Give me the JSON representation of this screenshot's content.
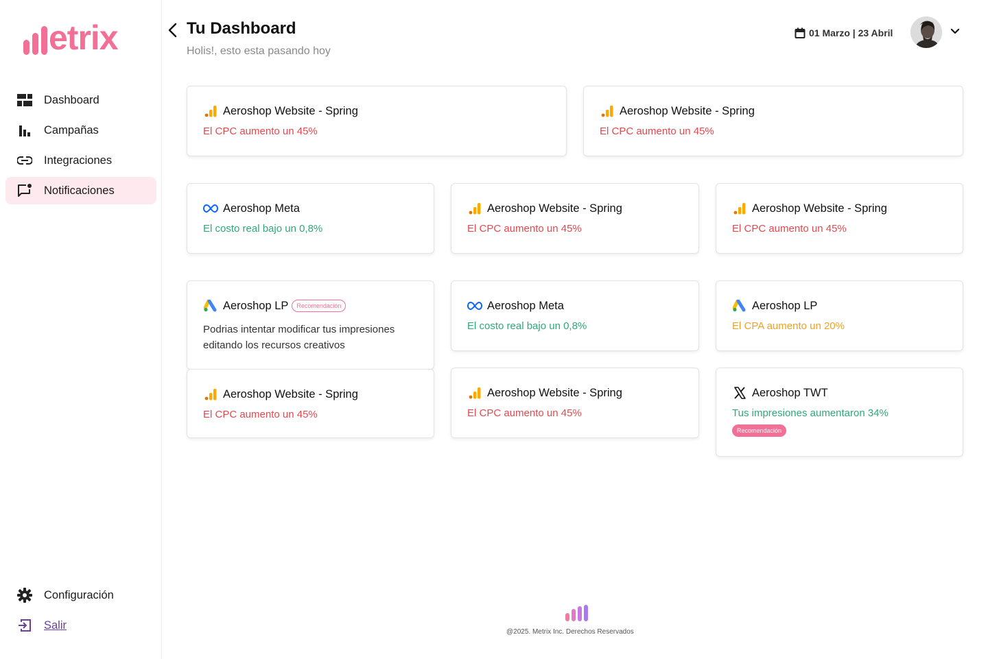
{
  "brand": {
    "name": "etrix",
    "color": "#f26f95"
  },
  "sidebar": {
    "items": [
      {
        "label": "Dashboard",
        "icon": "dashboard-icon"
      },
      {
        "label": "Campañas",
        "icon": "bar-chart-icon"
      },
      {
        "label": "Integraciones",
        "icon": "link-icon"
      },
      {
        "label": "Notificaciones",
        "icon": "notification-icon",
        "active": true
      }
    ],
    "bottom": [
      {
        "label": "Configuración",
        "icon": "gear-icon"
      },
      {
        "label": "Salir",
        "icon": "logout-icon"
      }
    ]
  },
  "header": {
    "title": "Tu Dashboard",
    "subtitle": "Holis!, esto esta pasando hoy",
    "date_range": "01 Marzo | 23 Abril"
  },
  "cards": [
    {
      "title": "Aeroshop Website - Spring",
      "message": "El CPC aumento un 45%",
      "icon": "google-analytics-icon",
      "tone": "red"
    },
    {
      "title": "Aeroshop Website - Spring",
      "message": "El CPC aumento un 45%",
      "icon": "google-analytics-icon",
      "tone": "red"
    },
    {
      "title": "Aeroshop Meta",
      "message": "El costo real bajo un 0,8%",
      "icon": "meta-icon",
      "tone": "green"
    },
    {
      "title": "Aeroshop Website - Spring",
      "message": "El CPC aumento un 45%",
      "icon": "google-analytics-icon",
      "tone": "red"
    },
    {
      "title": "Aeroshop Website - Spring",
      "message": "El CPC aumento un 45%",
      "icon": "google-analytics-icon",
      "tone": "red"
    },
    {
      "title": "Aeroshop LP",
      "badge": "Recomendación",
      "description": "Podrias intentar modificar tus impresiones editando los recursos creativos",
      "icon": "google-ads-icon"
    },
    {
      "title": "Aeroshop Meta",
      "message": "El costo real bajo un 0,8%",
      "icon": "meta-icon",
      "tone": "green"
    },
    {
      "title": "Aeroshop LP",
      "message": "El CPA aumento un 20%",
      "icon": "google-ads-icon",
      "tone": "orange"
    },
    {
      "title": "Aeroshop Website - Spring",
      "message": "El CPC aumento un 45%",
      "icon": "google-analytics-icon",
      "tone": "red"
    },
    {
      "title": "Aeroshop Website - Spring",
      "message": "El CPC aumento un 45%",
      "icon": "google-analytics-icon",
      "tone": "red"
    },
    {
      "title": "Aeroshop TWT",
      "message": "Tus impresiones aumentaron 34%",
      "badge": "Recomendación",
      "icon": "x-twitter-icon",
      "tone": "green"
    }
  ],
  "footer": {
    "copyright": "@2025. Metrix Inc. Derechos Reservados"
  },
  "colors": {
    "red": "#e5484d",
    "green": "#2fa87a",
    "orange": "#f0a127",
    "pink": "#f26f95",
    "active_bg": "#fde9ee"
  }
}
